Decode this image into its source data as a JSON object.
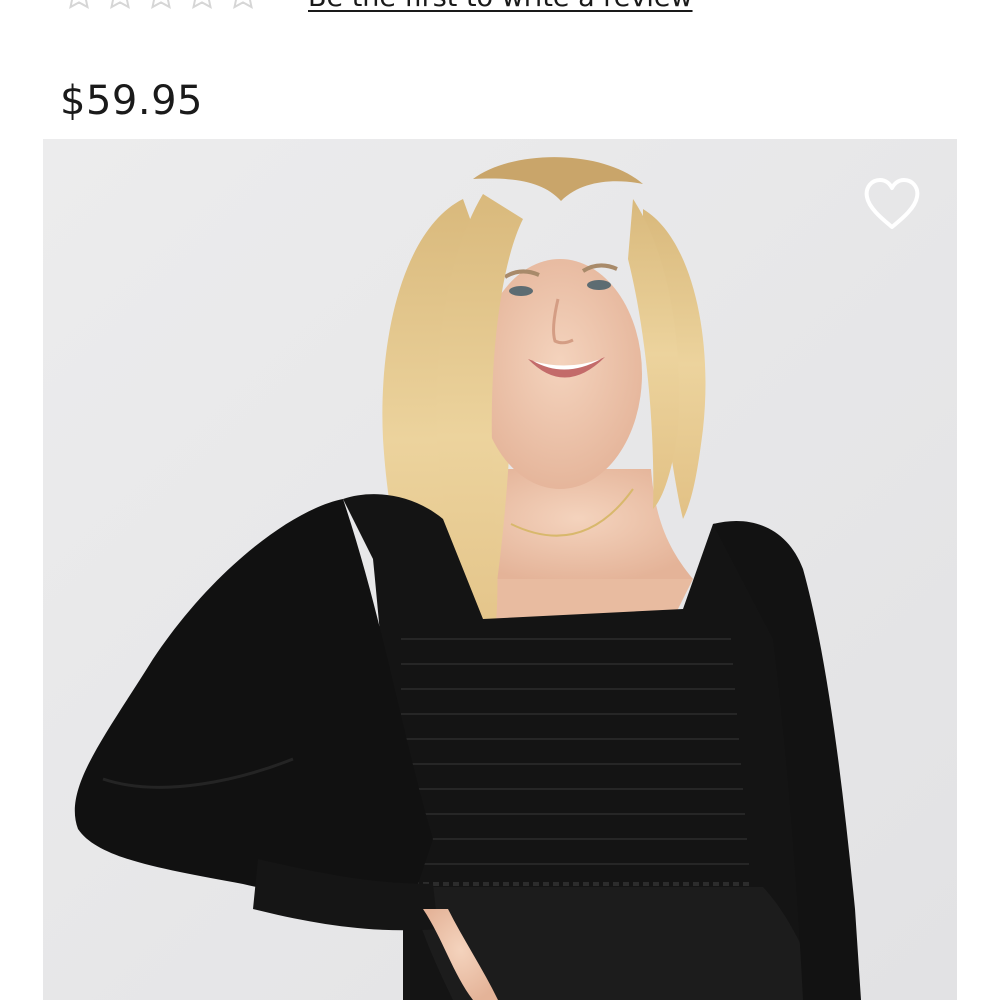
{
  "rating": {
    "stars_filled": 0,
    "stars_total": 5,
    "review_link": "Be the first to write a review"
  },
  "product": {
    "price": "$59.95",
    "image_alt": "Model wearing black smocked square neck long sleeve peplum top"
  },
  "wishlist": {
    "icon": "heart-outline-icon"
  },
  "colors": {
    "star_empty": "#d6d6d6",
    "text": "#1a1a1a",
    "image_bg": "#e7e7e8",
    "heart": "#ffffff"
  }
}
